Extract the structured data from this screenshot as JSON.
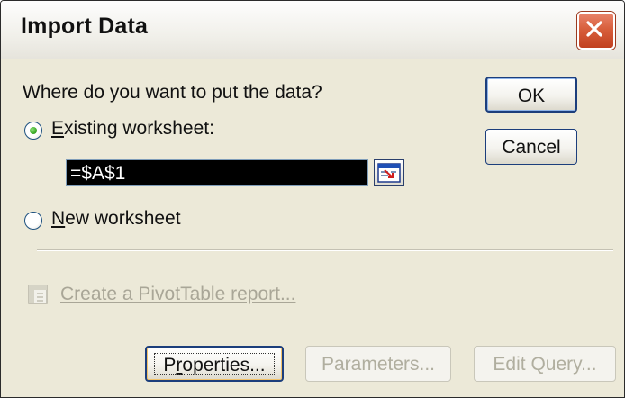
{
  "dialog": {
    "title": "Import Data",
    "question": "Where do you want to put the data?",
    "existing_worksheet": {
      "access_key": "E",
      "rest": "xisting worksheet:",
      "selected": true
    },
    "reference_value": "=$A$1",
    "new_worksheet": {
      "access_key": "N",
      "rest": "ew worksheet",
      "selected": false
    },
    "pivot_link": "Create a PivotTable report...",
    "buttons": {
      "ok": "OK",
      "cancel": "Cancel",
      "properties_access_key": "r",
      "properties_pre": "P",
      "properties_post": "operties...",
      "parameters": "Parameters...",
      "edit_query": "Edit Query..."
    }
  },
  "colors": {
    "dialog_bg": "#ece9d8",
    "button_border": "#1c3e7c",
    "close_button": "#d85f3c",
    "disabled_text": "#a9a697"
  },
  "icons": [
    "close-icon",
    "collapse-dialog-icon",
    "pivottable-icon"
  ]
}
